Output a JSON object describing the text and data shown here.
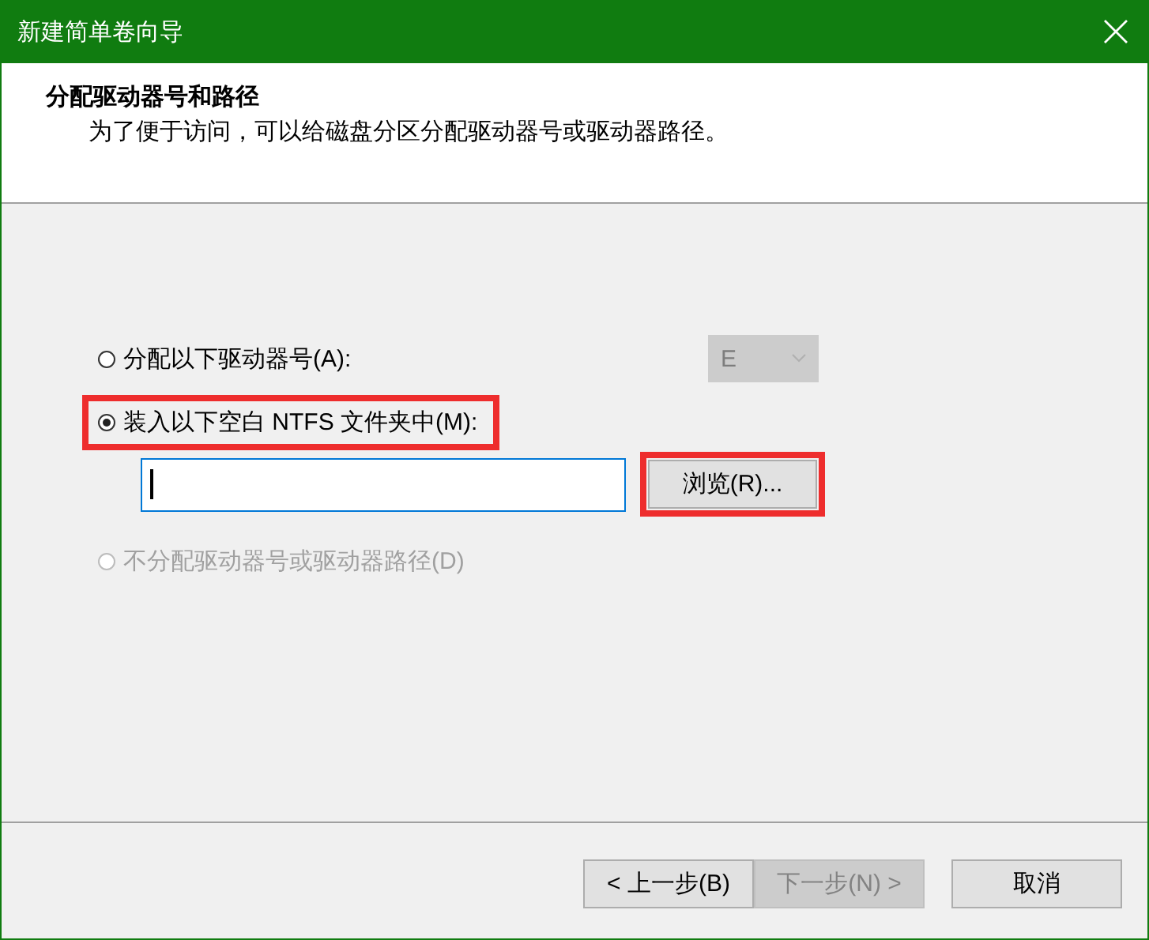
{
  "window": {
    "title": "新建简单卷向导"
  },
  "header": {
    "title": "分配驱动器号和路径",
    "subtitle": "为了便于访问，可以给磁盘分区分配驱动器号或驱动器路径。"
  },
  "options": [
    {
      "kind": "drive",
      "label": "分配以下驱动器号(A):",
      "selected": false,
      "disabled": false,
      "highlighted": false,
      "drive_letter": {
        "value": "E",
        "disabled": true
      }
    },
    {
      "kind": "folder",
      "label": "装入以下空白 NTFS 文件夹中(M):",
      "selected": true,
      "disabled": false,
      "highlighted": true,
      "path_field": {
        "focused": true
      },
      "browse_button": {
        "label": "浏览(R)...",
        "highlighted": true
      }
    },
    {
      "kind": "none",
      "label": "不分配驱动器号或驱动器路径(D)",
      "selected": false,
      "disabled": true,
      "highlighted": false
    }
  ],
  "buttons": [
    {
      "label": "< 上一步(B)",
      "disabled": false
    },
    {
      "label": "下一步(N) >",
      "disabled": true
    },
    {
      "label": "取消",
      "disabled": false
    }
  ]
}
